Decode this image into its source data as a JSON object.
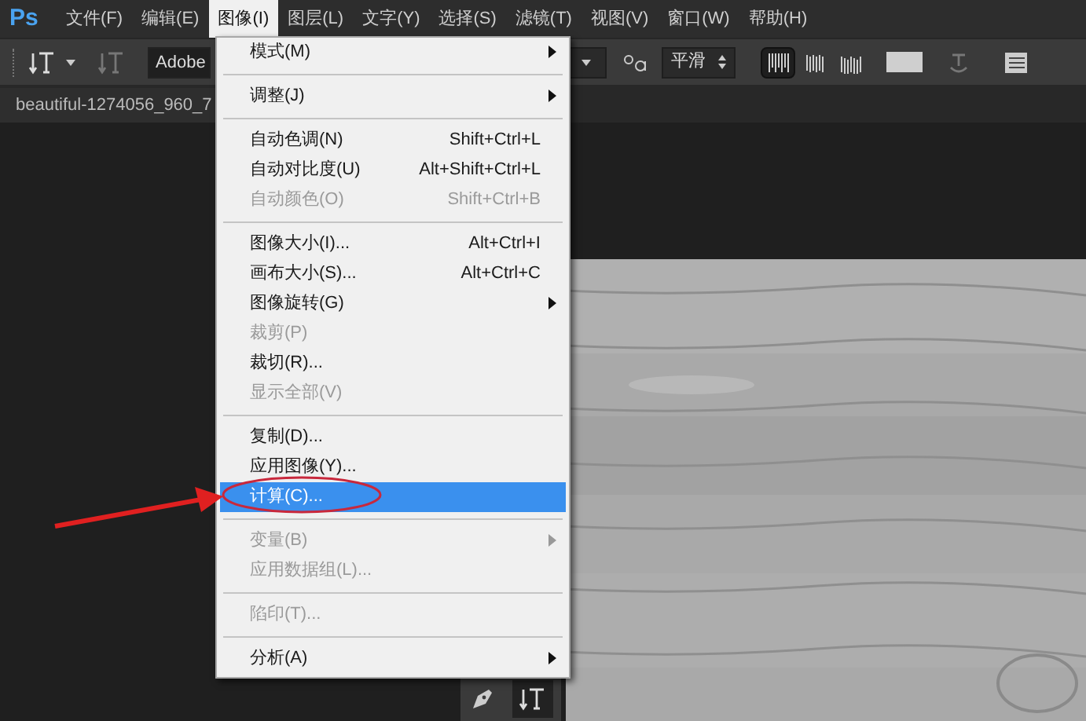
{
  "app": {
    "logo": "Ps"
  },
  "menubar": [
    {
      "label": "文件(F)",
      "selected": false
    },
    {
      "label": "编辑(E)",
      "selected": false
    },
    {
      "label": "图像(I)",
      "selected": true
    },
    {
      "label": "图层(L)",
      "selected": false
    },
    {
      "label": "文字(Y)",
      "selected": false
    },
    {
      "label": "选择(S)",
      "selected": false
    },
    {
      "label": "滤镜(T)",
      "selected": false
    },
    {
      "label": "视图(V)",
      "selected": false
    },
    {
      "label": "窗口(W)",
      "selected": false
    },
    {
      "label": "帮助(H)",
      "selected": false
    }
  ],
  "options_bar": {
    "font_field": "Adobe",
    "antialias": "平滑",
    "align": [
      {
        "selected": true
      },
      {
        "selected": false
      },
      {
        "selected": false
      }
    ]
  },
  "document_tab": {
    "title": "beautiful-1274056_960_7"
  },
  "menu": [
    {
      "kind": "item",
      "label": "模式(M)",
      "submenu": true,
      "disabled": false,
      "selected": false
    },
    {
      "kind": "separator"
    },
    {
      "kind": "item",
      "label": "调整(J)",
      "submenu": true,
      "disabled": false,
      "selected": false
    },
    {
      "kind": "separator"
    },
    {
      "kind": "item",
      "label": "自动色调(N)",
      "shortcut": "Shift+Ctrl+L",
      "disabled": false,
      "selected": false
    },
    {
      "kind": "item",
      "label": "自动对比度(U)",
      "shortcut": "Alt+Shift+Ctrl+L",
      "disabled": false,
      "selected": false
    },
    {
      "kind": "item",
      "label": "自动颜色(O)",
      "shortcut": "Shift+Ctrl+B",
      "disabled": true,
      "selected": false
    },
    {
      "kind": "separator"
    },
    {
      "kind": "item",
      "label": "图像大小(I)...",
      "shortcut": "Alt+Ctrl+I",
      "disabled": false,
      "selected": false
    },
    {
      "kind": "item",
      "label": "画布大小(S)...",
      "shortcut": "Alt+Ctrl+C",
      "disabled": false,
      "selected": false
    },
    {
      "kind": "item",
      "label": "图像旋转(G)",
      "submenu": true,
      "disabled": false,
      "selected": false
    },
    {
      "kind": "item",
      "label": "裁剪(P)",
      "disabled": true,
      "selected": false
    },
    {
      "kind": "item",
      "label": "裁切(R)...",
      "disabled": false,
      "selected": false
    },
    {
      "kind": "item",
      "label": "显示全部(V)",
      "disabled": true,
      "selected": false
    },
    {
      "kind": "separator"
    },
    {
      "kind": "item",
      "label": "复制(D)...",
      "disabled": false,
      "selected": false
    },
    {
      "kind": "item",
      "label": "应用图像(Y)...",
      "disabled": false,
      "selected": false
    },
    {
      "kind": "item",
      "label": "计算(C)...",
      "disabled": false,
      "selected": true
    },
    {
      "kind": "separator"
    },
    {
      "kind": "item",
      "label": "变量(B)",
      "submenu": true,
      "disabled": true,
      "selected": false
    },
    {
      "kind": "item",
      "label": "应用数据组(L)...",
      "disabled": true,
      "selected": false
    },
    {
      "kind": "separator"
    },
    {
      "kind": "item",
      "label": "陷印(T)...",
      "disabled": true,
      "selected": false
    },
    {
      "kind": "separator"
    },
    {
      "kind": "item",
      "label": "分析(A)",
      "submenu": true,
      "disabled": false,
      "selected": false
    }
  ]
}
